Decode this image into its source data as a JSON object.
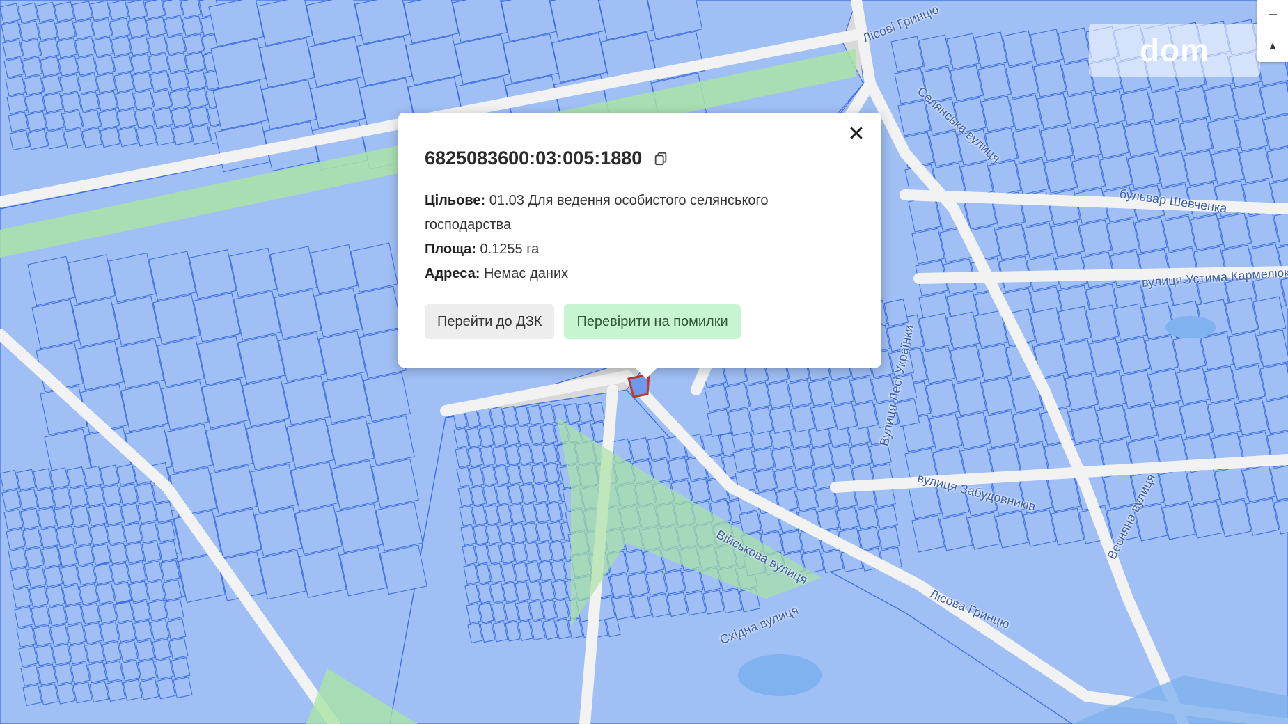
{
  "map": {
    "colors": {
      "background": "#d9d9d9",
      "parcel_fill": "#9fbff5",
      "parcel_stroke": "#3b6be0",
      "road": "#f2f2f2",
      "green": "#a9e3a4",
      "water": "#7fb2ee",
      "selected_stroke": "#c0392b"
    },
    "watermark": "dom",
    "zoom_in": "+",
    "zoom_out": "−",
    "reset_north": "▲",
    "streets": [
      "Лісові Гринцю",
      "Селянська вулиця",
      "бульвар Шевченка",
      "вулиця Устима Кармелюка",
      "Лісова Гринцю",
      "вулиця Забудовників",
      "Військова вулиця",
      "Східна вулиця",
      "Весняна вулиця",
      "Вулиця Лесі Українки"
    ]
  },
  "popup": {
    "cadastral_number": "6825083600:03:005:1880",
    "purpose_label": "Цільове:",
    "purpose_value": "01.03 Для ведення особистого селянського",
    "purpose_value_2": "господарства",
    "area_label": "Площа:",
    "area_value": "0.1255 га",
    "address_label": "Адреса:",
    "address_value": "Немає даних",
    "button_dzk": "Перейти до ДЗК",
    "button_check": "Перевірити на помилки",
    "close": "✕"
  }
}
